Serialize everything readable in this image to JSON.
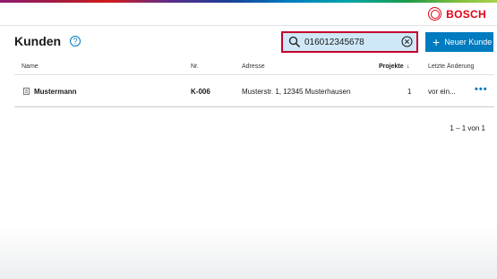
{
  "brand": {
    "logo_text": "BOSCH"
  },
  "page": {
    "title": "Kunden",
    "help_icon": "?"
  },
  "search": {
    "value": "016012345678",
    "placeholder": ""
  },
  "actions": {
    "new_customer": "Neuer Kunde"
  },
  "table": {
    "headers": {
      "name": "Name",
      "nr": "Nr.",
      "address": "Adresse",
      "projects": "Projekte",
      "projects_sort_icon": "↓",
      "last_change": "Letzte Änderung"
    },
    "rows": [
      {
        "name": "Mustermann",
        "nr": "K-006",
        "address": "Musterstr. 1, 12345 Musterhausen",
        "projects": "1",
        "last_change": "vor ein...",
        "more": "•••"
      }
    ]
  },
  "pagination": {
    "text": "1 – 1 von 1"
  },
  "colors": {
    "accent": "#007bc0",
    "brand_red": "#e20015",
    "search_highlight": "#c3002f",
    "search_bg": "#cfe8f7"
  },
  "icons": [
    "logo-icon",
    "help-icon",
    "search-icon",
    "clear-icon",
    "plus-icon",
    "building-icon",
    "sort-down-icon",
    "more-icon"
  ]
}
